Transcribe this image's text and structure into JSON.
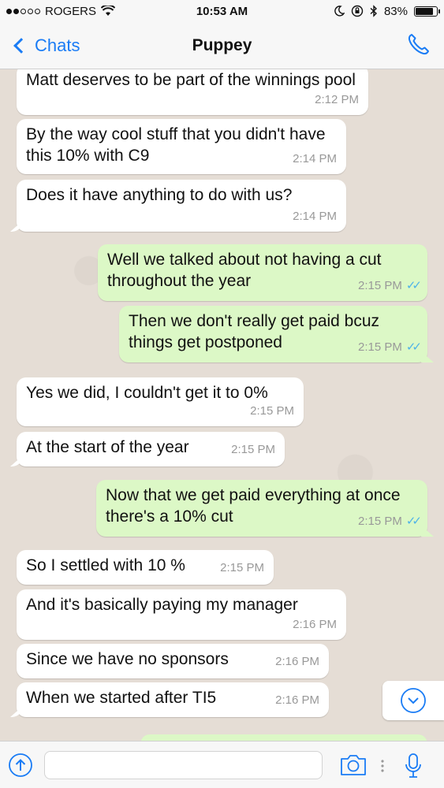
{
  "status_bar": {
    "carrier": "ROGERS",
    "time": "10:53 AM",
    "battery": "83%",
    "battery_level": 0.83
  },
  "nav": {
    "back_label": "Chats",
    "title": "Puppey"
  },
  "messages": [
    {
      "dir": "in",
      "text": "Matt deserves to be part of the winnings pool",
      "time": "2:12 PM"
    },
    {
      "dir": "in",
      "text": "By the way cool stuff that you didn't have this 10% with C9",
      "time": "2:14 PM"
    },
    {
      "dir": "in",
      "text": "Does it have anything to do with us?",
      "time": "2:14 PM"
    },
    {
      "dir": "out",
      "text": "Well we talked about not having a cut throughout the year",
      "time": "2:15 PM"
    },
    {
      "dir": "out",
      "text": "Then we don't really get paid bcuz things get postponed",
      "time": "2:15 PM"
    },
    {
      "dir": "in",
      "text": "Yes we did, I couldn't get it to 0%",
      "time": "2:15 PM"
    },
    {
      "dir": "in",
      "text": "At the start of the year",
      "time": "2:15 PM"
    },
    {
      "dir": "out",
      "text": "Now that we get paid everything at once there's a 10% cut",
      "time": "2:15 PM"
    },
    {
      "dir": "in",
      "text": "So I settled with 10 %",
      "time": "2:15 PM"
    },
    {
      "dir": "in",
      "text": "And it's basically paying my manager",
      "time": "2:16 PM"
    },
    {
      "dir": "in",
      "text": "Since we have no sponsors",
      "time": "2:16 PM"
    },
    {
      "dir": "in",
      "text": "When we started after TI5",
      "time": "2:16 PM"
    }
  ],
  "input": {
    "placeholder": ""
  },
  "colors": {
    "accent": "#1a7cf5",
    "outgoing_bubble": "#dcf8c6",
    "incoming_bubble": "#ffffff",
    "read_ticks": "#4fb3e8",
    "chat_background": "#e5ddd5"
  },
  "icons": [
    "wifi-icon",
    "moon-icon",
    "orientation-lock-icon",
    "bluetooth-icon",
    "battery-icon",
    "chevron-left-icon",
    "phone-icon",
    "chevron-down-icon",
    "upload-icon",
    "camera-icon",
    "microphone-icon"
  ]
}
